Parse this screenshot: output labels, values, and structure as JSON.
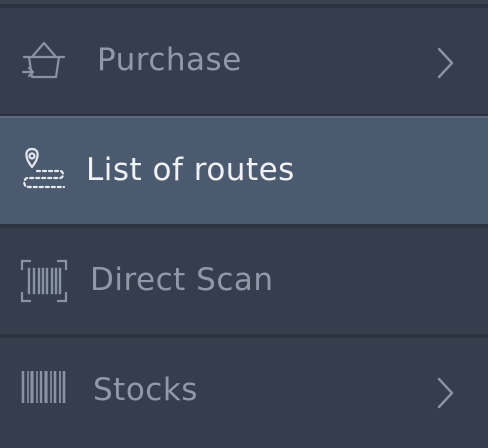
{
  "menu": {
    "items": [
      {
        "label": "Purchase",
        "icon": "basket-icon",
        "has_submenu": true,
        "selected": false
      },
      {
        "label": "List of routes",
        "icon": "route-pin-icon",
        "has_submenu": false,
        "selected": true
      },
      {
        "label": "Direct Scan",
        "icon": "barcode-scan-icon",
        "has_submenu": false,
        "selected": false
      },
      {
        "label": "Stocks",
        "icon": "barcode-icon",
        "has_submenu": true,
        "selected": false
      }
    ]
  },
  "colors": {
    "background": "#2b3240",
    "item": "#363e4d",
    "selected_item": "#4c5a70",
    "text": "#9099a8",
    "selected_text": "#eef1f5"
  }
}
